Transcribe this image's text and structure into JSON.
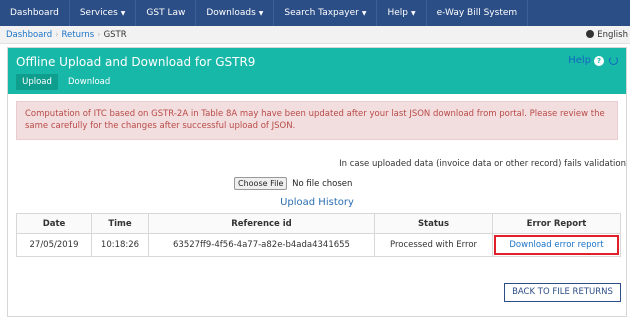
{
  "nav": {
    "items": [
      {
        "label": "Dashboard",
        "caret": false
      },
      {
        "label": "Services",
        "caret": true
      },
      {
        "label": "GST Law",
        "caret": false
      },
      {
        "label": "Downloads",
        "caret": true
      },
      {
        "label": "Search Taxpayer",
        "caret": true
      },
      {
        "label": "Help",
        "caret": true
      },
      {
        "label": "e-Way Bill System",
        "caret": false
      }
    ]
  },
  "breadcrumb": {
    "items": [
      "Dashboard",
      "Returns",
      "GSTR"
    ],
    "separator": "›",
    "language": "English"
  },
  "header": {
    "title": "Offline Upload and Download for GSTR9",
    "tabs": [
      "Upload",
      "Download"
    ],
    "help_label": "Help",
    "help_icon": "?"
  },
  "alert": {
    "message": "Computation of ITC based on GSTR-2A in Table 8A may have been updated after your last JSON download from portal. Please review the same carefully for the changes after successful upload of JSON."
  },
  "info_text": "In case uploaded data (invoice data or other record) fails validation",
  "file_input": {
    "button_label": "Choose File",
    "status": "No file chosen"
  },
  "upload_history": {
    "heading": "Upload History",
    "columns": [
      "Date",
      "Time",
      "Reference id",
      "Status",
      "Error Report"
    ],
    "rows": [
      {
        "date": "27/05/2019",
        "time": "10:18:26",
        "reference_id": "63527ff9-4f56-4a77-a82e-b4ada4341655",
        "status": "Processed with Error",
        "error_report": "Download error report"
      }
    ]
  },
  "back_button": "BACK TO FILE RETURNS",
  "colors": {
    "nav_bg": "#2c4e86",
    "header_bg": "#17b8a8",
    "alert_bg": "#f2dede",
    "alert_text": "#b94a48",
    "link": "#1a73c7",
    "highlight": "#e0202a"
  }
}
